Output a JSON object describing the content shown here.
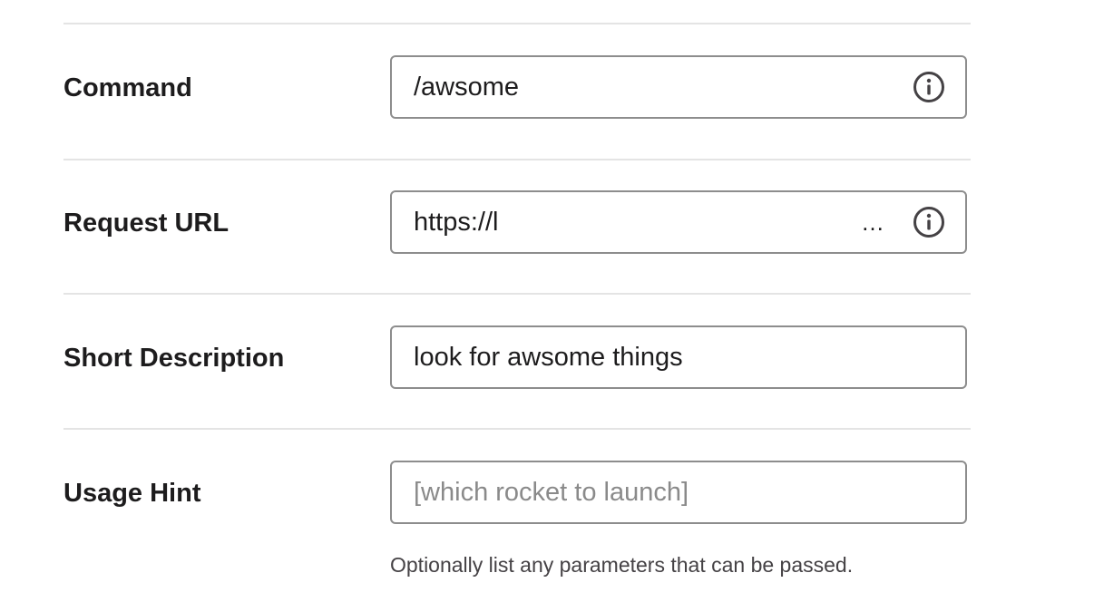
{
  "rows": [
    {
      "label": "Command",
      "value": "/awsome",
      "has_info_icon": true
    },
    {
      "label": "Request URL",
      "value": "https://l",
      "truncation": "…",
      "has_info_icon": true
    },
    {
      "label": "Short Description",
      "value": "look for awsome things",
      "has_info_icon": false
    },
    {
      "label": "Usage Hint",
      "placeholder": "[which rocket to launch]",
      "has_info_icon": false,
      "help_text": "Optionally list any parameters that can be passed."
    }
  ],
  "icons": {
    "info": "info-circle-icon"
  },
  "colors": {
    "text": "#1d1c1d",
    "border": "#8d8d8d",
    "divider": "#e4e4e4",
    "placeholder": "#8a8a8a",
    "help_text": "#454245"
  }
}
